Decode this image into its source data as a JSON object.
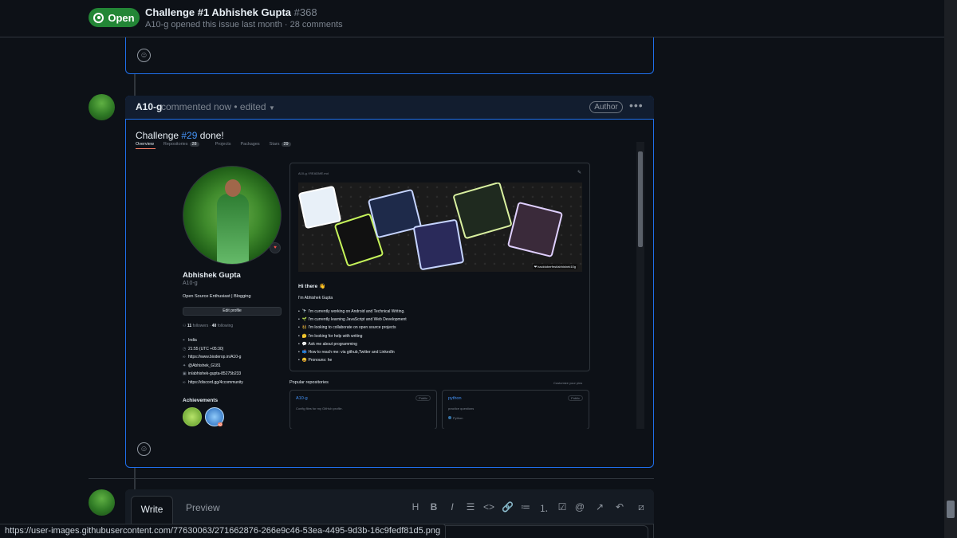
{
  "header": {
    "state_label": "Open",
    "title": "Challenge #1 Abhishek Gupta",
    "issue_number": "#368",
    "meta": "A10-g opened this issue last month · 28 comments"
  },
  "comment": {
    "author": "A10-g",
    "meta": "commented now • edited",
    "role_badge": "Author",
    "body_prefix": "Challenge ",
    "body_link": "#29",
    "body_suffix": " done!"
  },
  "embedded_profile": {
    "tabs": [
      {
        "label": "Overview",
        "count": ""
      },
      {
        "label": "Repositories",
        "count": "28"
      },
      {
        "label": "Projects",
        "count": ""
      },
      {
        "label": "Packages",
        "count": ""
      },
      {
        "label": "Stars",
        "count": "29"
      }
    ],
    "name": "Abhishek Gupta",
    "username": "A10-g",
    "bio": "Open Source Enthusiast | Blogging",
    "edit_button": "Edit profile",
    "followers": "11",
    "followers_label": "followers",
    "following": "40",
    "following_label": "following",
    "details": [
      {
        "icon": "location-icon",
        "glyph": "⌖",
        "text": "India"
      },
      {
        "icon": "clock-icon",
        "glyph": "◷",
        "text": "21:55 (UTC +05:30)"
      },
      {
        "icon": "link-icon",
        "glyph": "∞",
        "text": "https://www.bioderop.in/A10-g"
      },
      {
        "icon": "twitter-icon",
        "glyph": "✦",
        "text": "@Abhishek_G181"
      },
      {
        "icon": "linkedin-icon",
        "glyph": "▣",
        "text": "in/abhishek-gupta-85275b233"
      },
      {
        "icon": "link-icon",
        "glyph": "∞",
        "text": "https://discord.gg/4ccommunity"
      }
    ],
    "achievements_title": "Achievements",
    "achievement_multiplier": "x2",
    "readme_path": "A10-g / README.md",
    "banner_credit": "❤ hacktoberfest/abhishek10g",
    "greeting": "Hi there 👋",
    "intro": "I'm Abhishek Gupta",
    "bullets": [
      {
        "emoji": "🔭",
        "text": "I'm currently working on Android and Technical Writing."
      },
      {
        "emoji": "🌱",
        "text": "I'm currently learning JavaScript and Web Development"
      },
      {
        "emoji": "👯",
        "text": "I'm looking to collaborate on open source projects"
      },
      {
        "emoji": "🤔",
        "text": "I'm looking for help with writing"
      },
      {
        "emoji": "💬",
        "text": "Ask me about programming"
      },
      {
        "emoji": "📫",
        "text": "How to reach me: via github,Twitter and LinkedIn"
      },
      {
        "emoji": "😄",
        "text": "Pronouns: he"
      }
    ],
    "popular_title": "Popular repositories",
    "customize_link": "Customize your pins",
    "repos": [
      {
        "name": "A10-g",
        "visibility": "Public",
        "description": "Config files for my GitHub profile.",
        "language": ""
      },
      {
        "name": "python",
        "visibility": "Public",
        "description": "practice questions",
        "language": "Python"
      }
    ]
  },
  "composer": {
    "tab_write": "Write",
    "tab_preview": "Preview",
    "toolbar": [
      {
        "name": "heading-icon",
        "glyph": "H"
      },
      {
        "name": "bold-icon",
        "glyph": "B"
      },
      {
        "name": "italic-icon",
        "glyph": "I"
      },
      {
        "name": "quote-icon",
        "glyph": "☰"
      },
      {
        "name": "code-icon",
        "glyph": "<>"
      },
      {
        "name": "link-icon",
        "glyph": "🔗"
      },
      {
        "name": "unordered-list-icon",
        "glyph": "≔"
      },
      {
        "name": "ordered-list-icon",
        "glyph": "⒈"
      },
      {
        "name": "task-list-icon",
        "glyph": "☑"
      },
      {
        "name": "mention-icon",
        "glyph": "@"
      },
      {
        "name": "cross-reference-icon",
        "glyph": "↗"
      },
      {
        "name": "reply-icon",
        "glyph": "↶"
      },
      {
        "name": "slash-command-icon",
        "glyph": "⧄"
      }
    ]
  },
  "status_url": "https://user-images.githubusercontent.com/77630063/271662876-266e9c46-53ea-4495-9d3b-16c9fedf81d5.png",
  "colors": {
    "open_badge": "#238636",
    "link": "#4493f8",
    "focus_border": "#1f6feb",
    "bg": "#0d1117"
  }
}
